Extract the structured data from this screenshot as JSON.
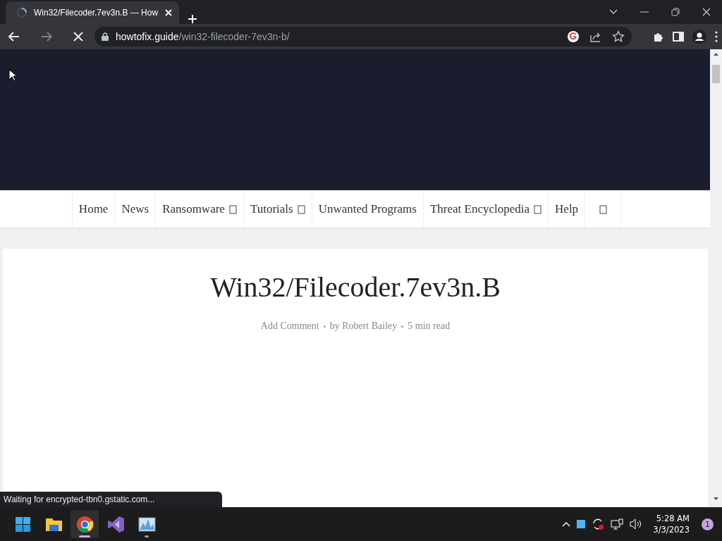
{
  "browser": {
    "tab": {
      "title": "Win32/Filecoder.7ev3n.B — How",
      "loading": true
    },
    "address": {
      "host": "howtofix.guide",
      "path": "/win32-filecoder-7ev3n-b/"
    },
    "status": "Waiting for encrypted-tbn0.gstatic.com..."
  },
  "nav": [
    {
      "kind": "link",
      "label": "Home",
      "dropdown": false
    },
    {
      "kind": "link",
      "label": "News",
      "dropdown": false
    },
    {
      "kind": "link",
      "label": "Ransomware",
      "dropdown": true
    },
    {
      "kind": "link",
      "label": "Tutorials",
      "dropdown": true
    },
    {
      "kind": "link",
      "label": "Unwanted Programs",
      "dropdown": false
    },
    {
      "kind": "link",
      "label": "Threat Encyclopedia",
      "dropdown": true
    },
    {
      "kind": "link",
      "label": "Help",
      "dropdown": false
    },
    {
      "kind": "icon"
    }
  ],
  "article": {
    "title": "Win32/Filecoder.7ev3n.B",
    "meta": [
      "Add Comment",
      "by Robert Bailey",
      "5 min read"
    ]
  },
  "taskbar": {
    "apps": [
      {
        "kind": "start",
        "selected": false,
        "running": false
      },
      {
        "kind": "folder",
        "selected": false,
        "running": false
      },
      {
        "kind": "chrome",
        "selected": true,
        "running": true
      },
      {
        "kind": "studio",
        "selected": false,
        "running": false
      },
      {
        "kind": "monitor",
        "selected": false,
        "running": true
      }
    ],
    "time": "5:28 AM",
    "date": "3/3/2023",
    "notifications": "1"
  }
}
